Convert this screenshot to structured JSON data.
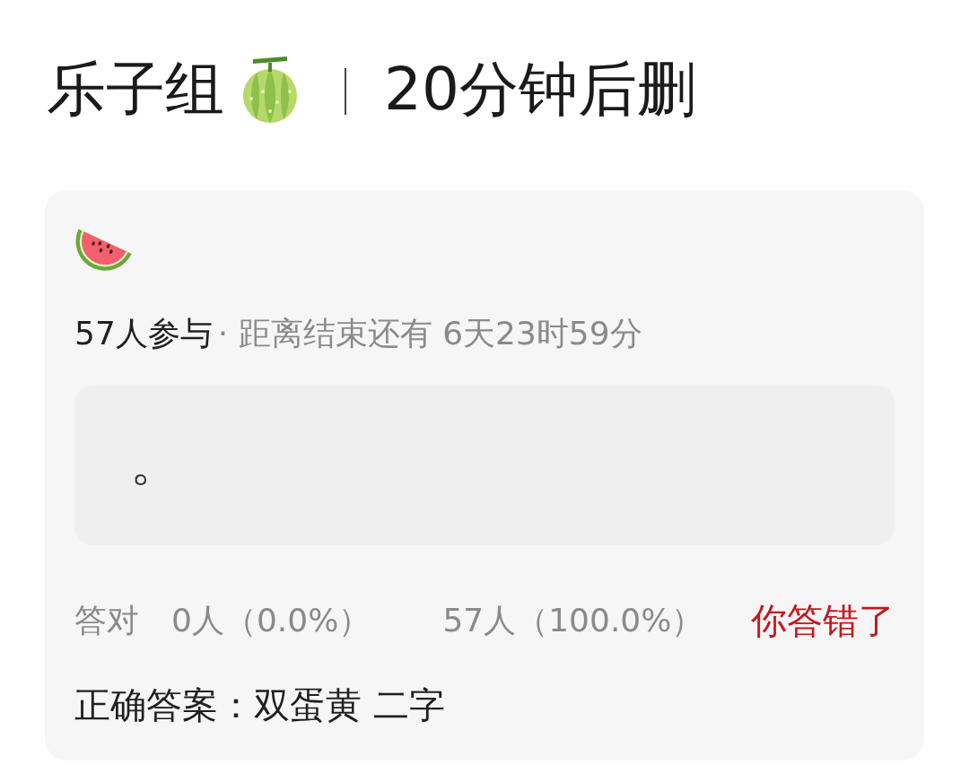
{
  "header": {
    "title": "乐子组",
    "note": "20分钟后删"
  },
  "poll": {
    "participants": "57人参与",
    "time_left": "· 距离结束还有 6天23时59分",
    "question": "。",
    "results": [
      {
        "label": "答对",
        "count": "0人（0.0%）"
      },
      {
        "count": "57人（100.0%）"
      }
    ],
    "verdict": {
      "text": "你答错了",
      "correct": false
    },
    "answer": "正确答案：双蛋黄 二字"
  }
}
